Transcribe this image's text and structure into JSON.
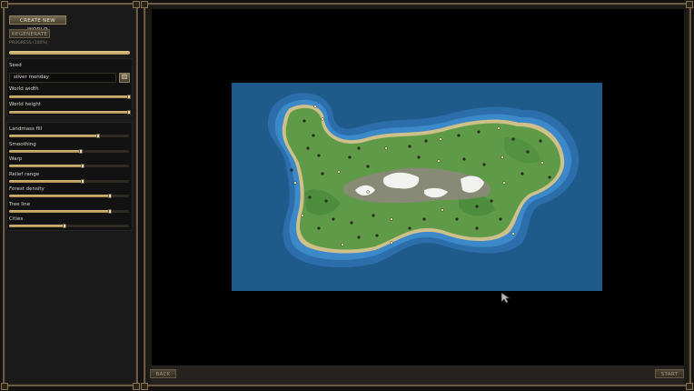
{
  "sidebar": {
    "create_new_world": "CREATE NEW WORLD",
    "regenerate": "REGENERATE",
    "progress_label": "PROGRESS (100%)",
    "progress": 1.0,
    "seed": {
      "label": "Seed",
      "value": "silver monday",
      "dice_icon": "dice-icon"
    },
    "world_width": {
      "label": "World width",
      "value": "3200",
      "fraction": 1.0
    },
    "world_height": {
      "label": "World height",
      "value": "1600",
      "fraction": 1.0
    },
    "params": [
      {
        "key": "landmass",
        "label": "Landmass fill",
        "value": "0.55",
        "fraction": 0.74
      },
      {
        "key": "smoothing",
        "label": "Smoothing",
        "value": "6",
        "fraction": 0.6
      },
      {
        "key": "warp",
        "label": "Warp",
        "value": "3.9",
        "fraction": 0.61
      },
      {
        "key": "relief",
        "label": "Relief range",
        "value": "0.75",
        "fraction": 0.61
      },
      {
        "key": "forest",
        "label": "Forest density",
        "value": "0.85",
        "fraction": 0.84
      },
      {
        "key": "treeline",
        "label": "Tree line",
        "value": "0.75",
        "fraction": 0.84
      },
      {
        "key": "cities",
        "label": "Cities",
        "value": "25",
        "fraction": 0.46
      }
    ]
  },
  "footer": {
    "back": "BACK",
    "start": "START"
  },
  "colors": {
    "accent": "#d9bf82",
    "value_green": "#8fe25a",
    "ocean": "#1f5c8c",
    "land": "#5f9a48"
  }
}
